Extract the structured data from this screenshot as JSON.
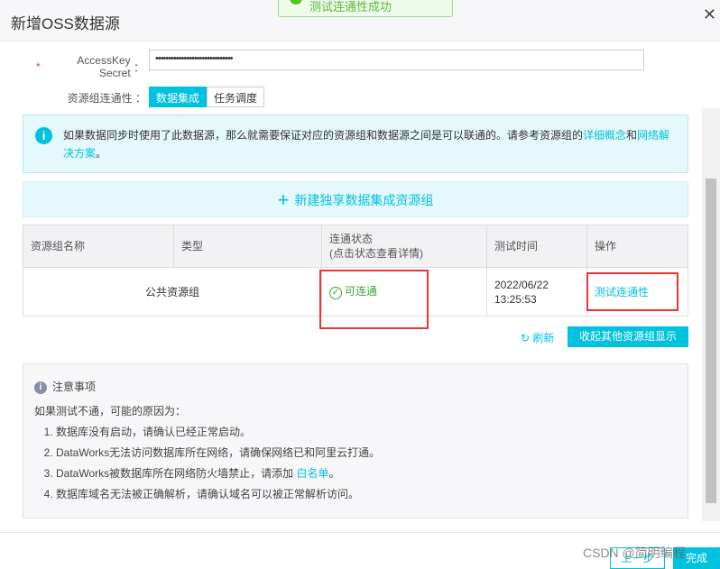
{
  "dialog": {
    "title": "新增OSS数据源",
    "toast": "测试连通性成功"
  },
  "form": {
    "secret_label": "AccessKey Secret",
    "secret_value": "••••••••••••••••••••••••••••••",
    "conn_label": "资源组连通性",
    "tabs": [
      "数据集成",
      "任务调度"
    ]
  },
  "info": {
    "text": "如果数据同步时使用了此数据源，那么就需要保证对应的资源组和数据源之间是可以联通的。请参考资源组的",
    "link1": "详细概念",
    "and": "和",
    "link2": "网络解决方案",
    "end": "。"
  },
  "add_group": "新建独享数据集成资源组",
  "table": {
    "headers": [
      "资源组名称",
      "类型",
      "连通状态",
      "测试时间",
      "操作"
    ],
    "status_hint": "(点击状态查看详情)",
    "rows": [
      {
        "name": "公共资源组",
        "type": "",
        "status": "可连通",
        "date": "2022/06/22",
        "time": "13:25:53",
        "action": "测试连通性"
      }
    ]
  },
  "refresh": "刷新",
  "collapse": "收起其他资源组显示",
  "notes": {
    "title": "注意事项",
    "intro": "如果测试不通，可能的原因为：",
    "items": [
      "数据库没有启动，请确认已经正常启动。",
      "DataWorks无法访问数据库所在网络，请确保网络已和阿里云打通。",
      "DataWorks被数据库所在网络防火墙禁止，请添加 ",
      "数据库域名无法被正确解析，请确认域名可以被正常解析访问。"
    ],
    "whitelist": "白名单",
    "period": "。"
  },
  "footer": {
    "prev": "上一步",
    "done": "完成",
    "watermark": "CSDN @简明编程"
  }
}
